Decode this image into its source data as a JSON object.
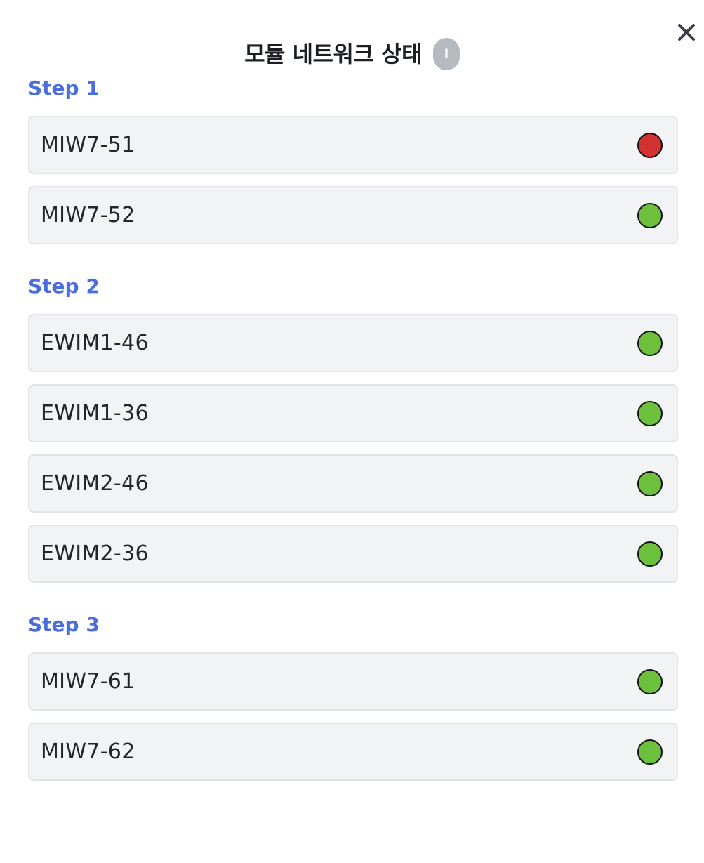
{
  "modal": {
    "title": "모듈 네트워크 상태",
    "info_icon_glyph": "i",
    "close_icon": "close-icon"
  },
  "colors": {
    "accent": "#4a6fdc",
    "status_ok": "#6cc03c",
    "status_error": "#d23232"
  },
  "steps": [
    {
      "title": "Step 1",
      "modules": [
        {
          "name": "MIW7-51",
          "status": "error"
        },
        {
          "name": "MIW7-52",
          "status": "ok"
        }
      ]
    },
    {
      "title": "Step 2",
      "modules": [
        {
          "name": "EWIM1-46",
          "status": "ok"
        },
        {
          "name": "EWIM1-36",
          "status": "ok"
        },
        {
          "name": "EWIM2-46",
          "status": "ok"
        },
        {
          "name": "EWIM2-36",
          "status": "ok"
        }
      ]
    },
    {
      "title": "Step 3",
      "modules": [
        {
          "name": "MIW7-61",
          "status": "ok"
        },
        {
          "name": "MIW7-62",
          "status": "ok"
        }
      ]
    }
  ]
}
